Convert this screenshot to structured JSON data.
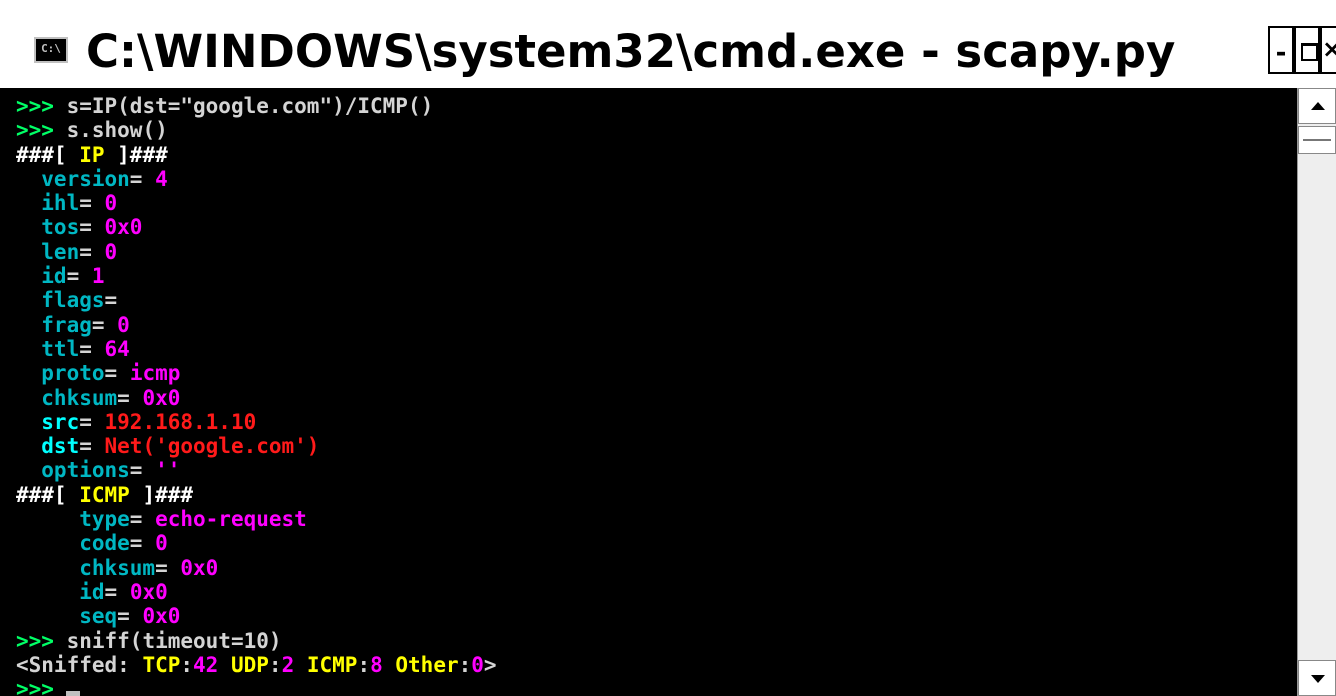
{
  "window": {
    "title": "C:\\WINDOWS\\system32\\cmd.exe - scapy.py",
    "icon": "cmd-icon",
    "icon_text": "C:\\",
    "controls": {
      "minimize": "-",
      "close": "×"
    }
  },
  "colors": {
    "prompt": "#00ff66",
    "field": "#00b7c3",
    "value": "#ff00ff",
    "header": "#ffff00",
    "address": "#ff1a1a"
  },
  "console": {
    "lines": [
      [
        {
          "t": ">>>",
          "c": "c-bgreen"
        },
        {
          "t": " s=IP(dst=\"google.com\")/ICMP()",
          "c": "c-gray"
        }
      ],
      [
        {
          "t": ">>>",
          "c": "c-bgreen"
        },
        {
          "t": " s.show()",
          "c": "c-gray"
        }
      ],
      [
        {
          "t": "###[ ",
          "c": "c-white"
        },
        {
          "t": "IP",
          "c": "c-yellow"
        },
        {
          "t": " ]###",
          "c": "c-white"
        }
      ],
      [
        {
          "t": "  version",
          "c": "c-cyan"
        },
        {
          "t": "= ",
          "c": "c-gray"
        },
        {
          "t": "4",
          "c": "c-mag"
        }
      ],
      [
        {
          "t": "  ihl",
          "c": "c-cyan"
        },
        {
          "t": "= ",
          "c": "c-gray"
        },
        {
          "t": "0",
          "c": "c-mag"
        }
      ],
      [
        {
          "t": "  tos",
          "c": "c-cyan"
        },
        {
          "t": "= ",
          "c": "c-gray"
        },
        {
          "t": "0x0",
          "c": "c-mag"
        }
      ],
      [
        {
          "t": "  len",
          "c": "c-cyan"
        },
        {
          "t": "= ",
          "c": "c-gray"
        },
        {
          "t": "0",
          "c": "c-mag"
        }
      ],
      [
        {
          "t": "  id",
          "c": "c-cyan"
        },
        {
          "t": "= ",
          "c": "c-gray"
        },
        {
          "t": "1",
          "c": "c-mag"
        }
      ],
      [
        {
          "t": "  flags",
          "c": "c-cyan"
        },
        {
          "t": "= ",
          "c": "c-gray"
        }
      ],
      [
        {
          "t": "  frag",
          "c": "c-cyan"
        },
        {
          "t": "= ",
          "c": "c-gray"
        },
        {
          "t": "0",
          "c": "c-mag"
        }
      ],
      [
        {
          "t": "  ttl",
          "c": "c-cyan"
        },
        {
          "t": "= ",
          "c": "c-gray"
        },
        {
          "t": "64",
          "c": "c-mag"
        }
      ],
      [
        {
          "t": "  proto",
          "c": "c-cyan"
        },
        {
          "t": "= ",
          "c": "c-gray"
        },
        {
          "t": "icmp",
          "c": "c-mag"
        }
      ],
      [
        {
          "t": "  chksum",
          "c": "c-cyan"
        },
        {
          "t": "= ",
          "c": "c-gray"
        },
        {
          "t": "0x0",
          "c": "c-mag"
        }
      ],
      [
        {
          "t": "  src",
          "c": "c-bcyan"
        },
        {
          "t": "= ",
          "c": "c-gray"
        },
        {
          "t": "192.168.1.10",
          "c": "c-red"
        }
      ],
      [
        {
          "t": "  dst",
          "c": "c-bcyan"
        },
        {
          "t": "= ",
          "c": "c-gray"
        },
        {
          "t": "Net('google.com')",
          "c": "c-red"
        }
      ],
      [
        {
          "t": "  options",
          "c": "c-cyan"
        },
        {
          "t": "= ",
          "c": "c-gray"
        },
        {
          "t": "''",
          "c": "c-mag"
        }
      ],
      [
        {
          "t": "###[ ",
          "c": "c-white"
        },
        {
          "t": "ICMP",
          "c": "c-yellow"
        },
        {
          "t": " ]###",
          "c": "c-white"
        }
      ],
      [
        {
          "t": "     type",
          "c": "c-cyan"
        },
        {
          "t": "= ",
          "c": "c-gray"
        },
        {
          "t": "echo-request",
          "c": "c-mag"
        }
      ],
      [
        {
          "t": "     code",
          "c": "c-cyan"
        },
        {
          "t": "= ",
          "c": "c-gray"
        },
        {
          "t": "0",
          "c": "c-mag"
        }
      ],
      [
        {
          "t": "     chksum",
          "c": "c-cyan"
        },
        {
          "t": "= ",
          "c": "c-gray"
        },
        {
          "t": "0x0",
          "c": "c-mag"
        }
      ],
      [
        {
          "t": "     id",
          "c": "c-cyan"
        },
        {
          "t": "= ",
          "c": "c-gray"
        },
        {
          "t": "0x0",
          "c": "c-mag"
        }
      ],
      [
        {
          "t": "     seq",
          "c": "c-cyan"
        },
        {
          "t": "= ",
          "c": "c-gray"
        },
        {
          "t": "0x0",
          "c": "c-mag"
        }
      ],
      [
        {
          "t": ">>>",
          "c": "c-bgreen"
        },
        {
          "t": " sniff(timeout=10)",
          "c": "c-gray"
        }
      ],
      [
        {
          "t": "<Sniffed: ",
          "c": "c-gray"
        },
        {
          "t": "TCP",
          "c": "c-yellow"
        },
        {
          "t": ":",
          "c": "c-gray"
        },
        {
          "t": "42",
          "c": "c-mag"
        },
        {
          "t": " UDP",
          "c": "c-yellow"
        },
        {
          "t": ":",
          "c": "c-gray"
        },
        {
          "t": "2",
          "c": "c-mag"
        },
        {
          "t": " ICMP",
          "c": "c-yellow"
        },
        {
          "t": ":",
          "c": "c-gray"
        },
        {
          "t": "8",
          "c": "c-mag"
        },
        {
          "t": " Other",
          "c": "c-yellow"
        },
        {
          "t": ":",
          "c": "c-gray"
        },
        {
          "t": "0",
          "c": "c-mag"
        },
        {
          "t": ">",
          "c": "c-gray"
        }
      ],
      [
        {
          "t": ">>>",
          "c": "c-bgreen"
        }
      ]
    ]
  }
}
